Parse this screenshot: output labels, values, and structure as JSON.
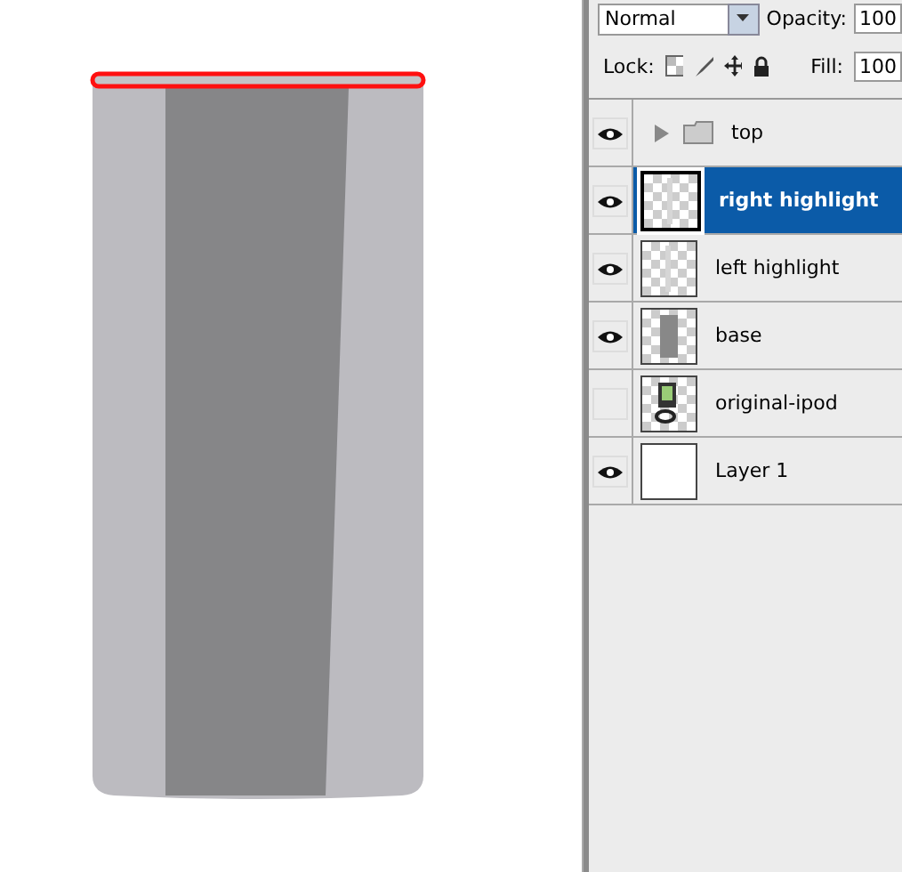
{
  "options_bar": {
    "blend_mode": "Normal",
    "opacity_label": "Opacity:",
    "opacity_value": "100",
    "lock_label": "Lock:",
    "fill_label": "Fill:",
    "fill_value": "100"
  },
  "layers": [
    {
      "name": "top",
      "kind": "group",
      "visible": true,
      "selected": false
    },
    {
      "name": "right highlight",
      "kind": "strip",
      "visible": true,
      "selected": true
    },
    {
      "name": "left highlight",
      "kind": "strip",
      "visible": true,
      "selected": false
    },
    {
      "name": "base",
      "kind": "bar",
      "visible": true,
      "selected": false
    },
    {
      "name": "original-ipod",
      "kind": "device",
      "visible": false,
      "selected": false
    },
    {
      "name": "Layer 1",
      "kind": "blank",
      "visible": true,
      "selected": false
    }
  ]
}
